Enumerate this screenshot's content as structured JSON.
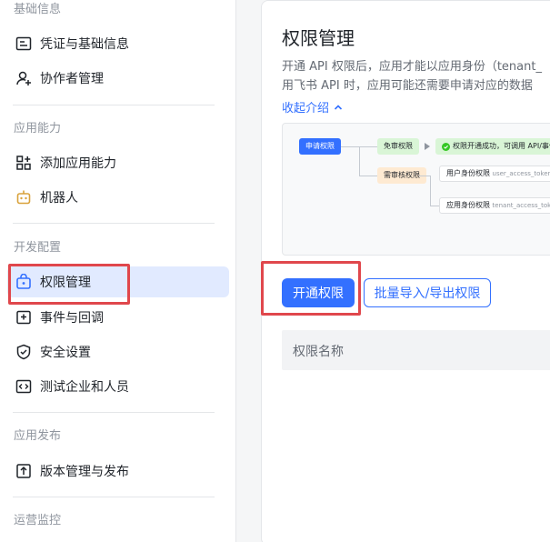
{
  "sidebar": {
    "sections": [
      {
        "title": "基础信息"
      },
      {
        "title": "应用能力"
      },
      {
        "title": "开发配置"
      },
      {
        "title": "应用发布"
      },
      {
        "title": "运营监控"
      }
    ],
    "items": [
      {
        "label": "凭证与基础信息",
        "icon": "id-card-icon"
      },
      {
        "label": "协作者管理",
        "icon": "add-user-icon"
      },
      {
        "label": "添加应用能力",
        "icon": "apps-grid-icon"
      },
      {
        "label": "机器人",
        "icon": "robot-icon"
      },
      {
        "label": "权限管理",
        "icon": "lock-icon",
        "active": true
      },
      {
        "label": "事件与回调",
        "icon": "event-icon"
      },
      {
        "label": "安全设置",
        "icon": "shield-icon"
      },
      {
        "label": "测试企业和人员",
        "icon": "code-icon"
      },
      {
        "label": "版本管理与发布",
        "icon": "upload-icon"
      }
    ]
  },
  "main": {
    "title": "权限管理",
    "intro_line1": "开通 API 权限后，应用才能以应用身份（tenant_",
    "intro_line2": "用飞书 API 时，应用可能还需要申请对应的数据",
    "collapse_label": "收起介绍",
    "diagram": {
      "apply": "申请权限",
      "no_review": "免审权限",
      "success": "权限开通成功，可调用 API/事件",
      "need_review": "需审核权限",
      "user_identity": "用户身份权限",
      "user_token": "user_access_token 调用",
      "app_identity": "应用身份权限",
      "tenant_token": "tenant_access_token 调用"
    },
    "open_button": "开通权限",
    "batch_button": "批量导入/导出权限",
    "table_header": "权限名称"
  },
  "colors": {
    "primary": "#3370ff",
    "active_bg": "#e1eaff",
    "highlight": "#e0474c"
  }
}
